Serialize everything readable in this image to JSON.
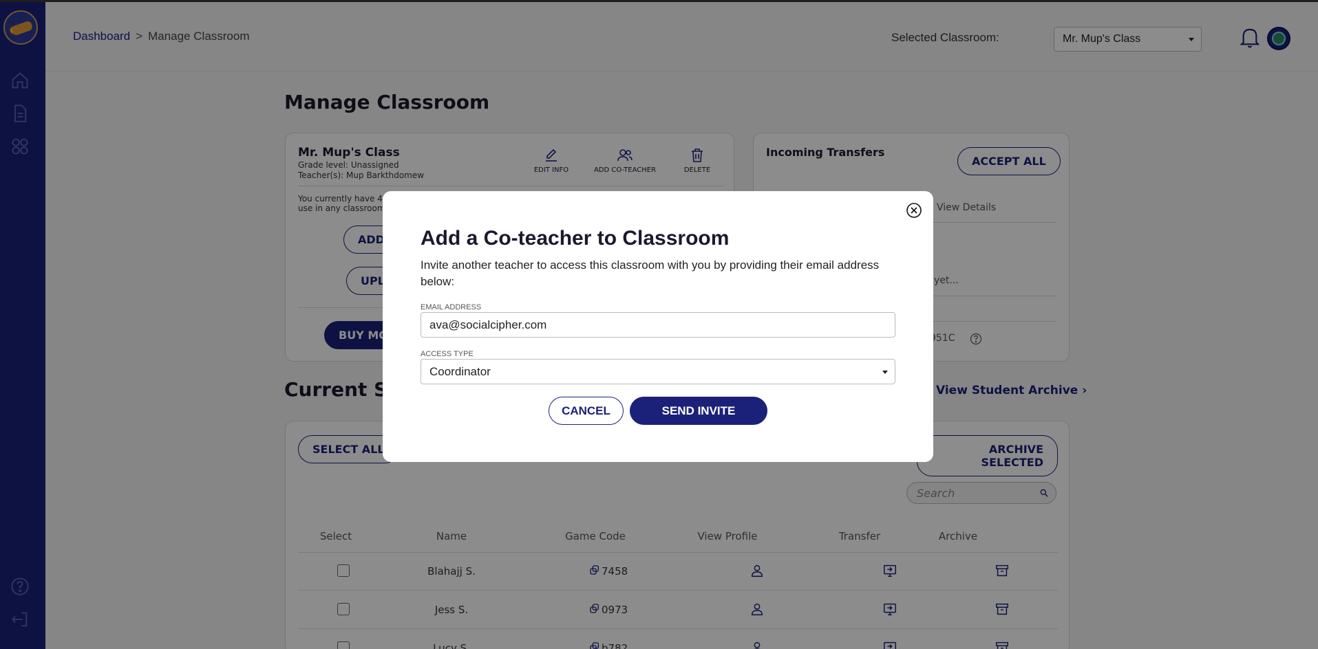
{
  "breadcrumb": {
    "root": "Dashboard",
    "separator": ">",
    "current": "Manage Classroom"
  },
  "header": {
    "selected_label": "Selected Classroom:",
    "selected_value": "Mr. Mup's Class"
  },
  "page": {
    "title": "Manage Classroom"
  },
  "class_card": {
    "name": "Mr. Mup's Class",
    "grade_label": "Grade level:",
    "grade_value": "Unassigned",
    "teachers_label": "Teacher(s):",
    "teachers_value": "Mup Barkthdomew",
    "actions": {
      "edit": "EDIT INFO",
      "add_coteacher": "ADD CO-TEACHER",
      "delete": "DELETE"
    },
    "info_line1": "You currently have 4",
    "info_line2": "use in any classroom",
    "btn_add": "ADD",
    "btn_upload": "UPL",
    "btn_buy": "BUY MO"
  },
  "transfers": {
    "title": "Incoming Transfers",
    "accept_all": "ACCEPT ALL",
    "view_details": "View Details",
    "empty_text": "yet...",
    "code_text": "951C"
  },
  "students": {
    "section_title": "Current St",
    "archive_link": "View Student Archive",
    "select_all": "SELECT ALL",
    "archive_selected": "ARCHIVE SELECTED",
    "search_placeholder": "Search",
    "columns": [
      "Select",
      "Name",
      "Game Code",
      "View Profile",
      "Transfer",
      "Archive"
    ],
    "rows": [
      {
        "name": "Blahajj S.",
        "code": "7458"
      },
      {
        "name": "Jess S.",
        "code": "0973"
      },
      {
        "name": "Lucy S.",
        "code": "b782"
      }
    ]
  },
  "modal": {
    "title": "Add a Co-teacher to Classroom",
    "description": "Invite another teacher to access this classroom with you by providing their email address below:",
    "email_label": "EMAIL ADDRESS",
    "email_value": "ava@socialcipher.com",
    "access_label": "ACCESS TYPE",
    "access_value": "Coordinator",
    "cancel_label": "CANCEL",
    "send_label": "SEND INVITE"
  },
  "colors": {
    "brand": "#1b2179",
    "overlay": "rgba(0,0,0,0.45)"
  },
  "icons": [
    "home-icon",
    "document-icon",
    "apps-icon",
    "help-icon",
    "logout-icon",
    "bell-icon",
    "edit-icon",
    "add-user-icon",
    "trash-icon",
    "search-icon",
    "copy-icon",
    "profile-icon",
    "transfer-icon",
    "archive-icon",
    "close-icon",
    "help-circle-icon"
  ]
}
